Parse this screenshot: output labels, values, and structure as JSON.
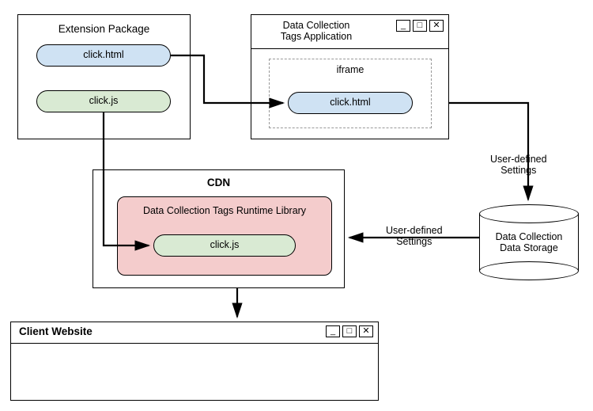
{
  "extension": {
    "title": "Extension Package",
    "file_html": "click.html",
    "file_js": "click.js"
  },
  "tags_app": {
    "title": "Data Collection\nTags Application",
    "iframe_label": "iframe",
    "iframe_file": "click.html"
  },
  "cdn": {
    "title": "CDN",
    "runtime_title": "Data Collection Tags Runtime Library",
    "runtime_file": "click.js"
  },
  "storage": {
    "label": "Data Collection\nData Storage"
  },
  "client": {
    "title": "Client Website"
  },
  "arrows": {
    "settings1": "User-defined\nSettings",
    "settings2": "User-defined\nSettings"
  }
}
